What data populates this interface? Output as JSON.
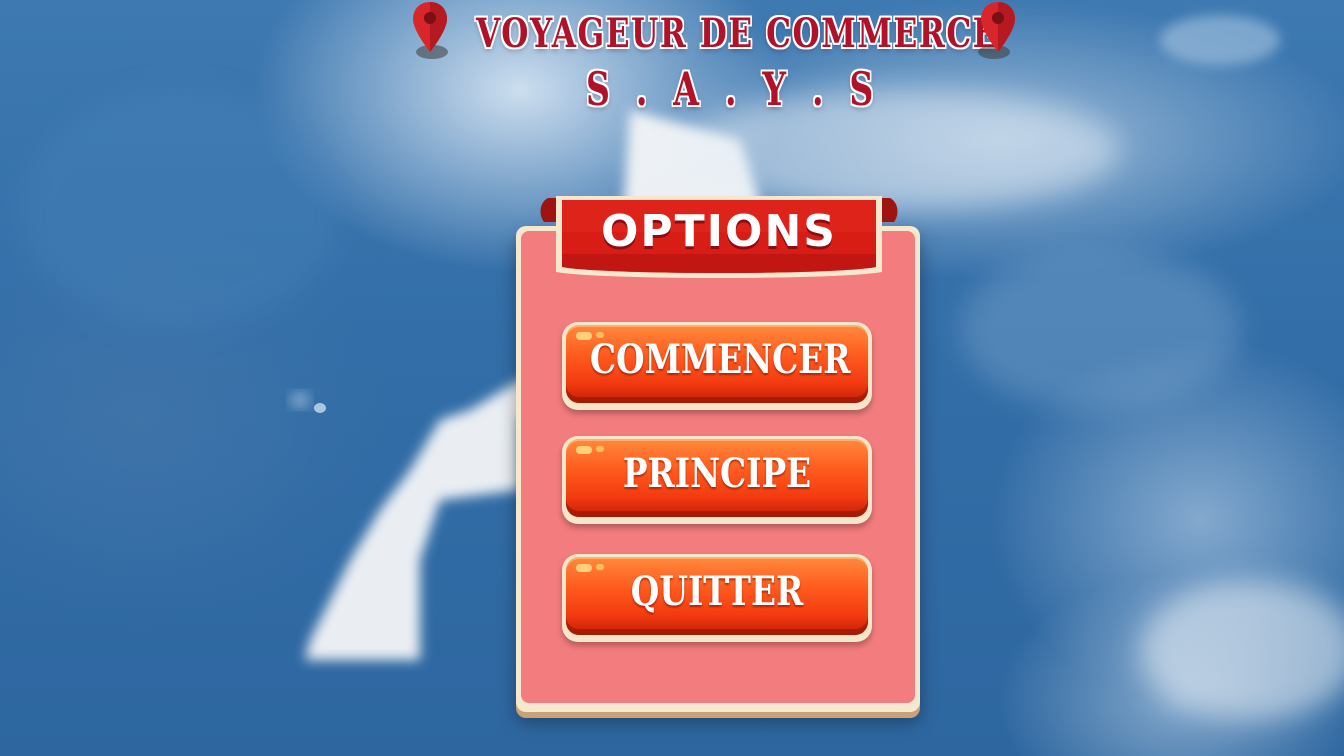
{
  "screen": "options-menu",
  "title": {
    "line1": "VOYAGEUR DE COMMERCE",
    "line2": "S . A . Y . S",
    "color": "#b0122a"
  },
  "icons": {
    "title_left": "map-pin-icon",
    "title_right": "map-pin-icon"
  },
  "panel": {
    "header": "OPTIONS",
    "background": "#f27c7e",
    "ribbon_color": "#d81d16",
    "buttons": [
      {
        "label": "COMMENCER"
      },
      {
        "label": "PRINCIPE"
      },
      {
        "label": "QUITTER"
      }
    ],
    "button_color": "#ff5a1d"
  }
}
